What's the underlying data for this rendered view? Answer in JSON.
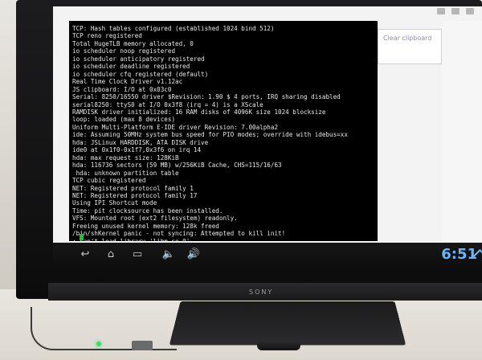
{
  "clipboard": {
    "clear_label": "Clear clipboard"
  },
  "terminal": {
    "lines": [
      "TCP: Hash tables configured (established 1024 bind 512)",
      "TCP reno registered",
      "Total HugeTLB memory allocated, 0",
      "io scheduler noop registered",
      "io scheduler anticipatory registered",
      "io scheduler deadline registered",
      "io scheduler cfq registered (default)",
      "Real Time Clock Driver v1.12ac",
      "JS clipboard: I/O at 0x03c0",
      "Serial: 8250/16550 driver $Revision: 1.90 $ 4 ports, IRQ sharing disabled",
      "serial8250: ttyS0 at I/O 0x3f8 (irq = 4) is a XScale",
      "RAMDISK driver initialized: 16 RAM disks of 4096K size 1024 blocksize",
      "loop: loaded (max 8 devices)",
      "Uniform Multi-Platform E-IDE driver Revision: 7.00alpha2",
      "ide: Assuming 50MHz system bus speed for PIO modes; override with idebus=xx",
      "hda: JSLinux HARDDISK, ATA DISK drive",
      "ide0 at 0x1f0-0x1f7,0x3f6 on irq 14",
      "hda: max request size: 128KiB",
      "hda: 116736 sectors (59 MB) w/256KiB Cache, CHS=115/16/63",
      " hda: unknown partition table",
      "TCP cubic registered",
      "NET: Registered protocol family 1",
      "NET: Registered protocol family 17",
      "Using IPI Shortcut mode",
      "Time: pit clocksource has been installed.",
      "VFS: Mounted root (ext2 filesystem) readonly.",
      "Freeing unused kernel memory: 128k freed",
      "/bin/shKernel panic - not syncing: Attempted to kill init!",
      ": can't load library 'libm.so.0'"
    ]
  },
  "navbar": {
    "clock": "6:51",
    "buttons": [
      "back",
      "home",
      "recent-apps",
      "volume-down",
      "volume-up"
    ]
  },
  "tv": {
    "brand": "SONY"
  },
  "colors": {
    "terminal_bg": "#000000",
    "cursor": "#17c52e",
    "clock": "#66b6ff"
  }
}
